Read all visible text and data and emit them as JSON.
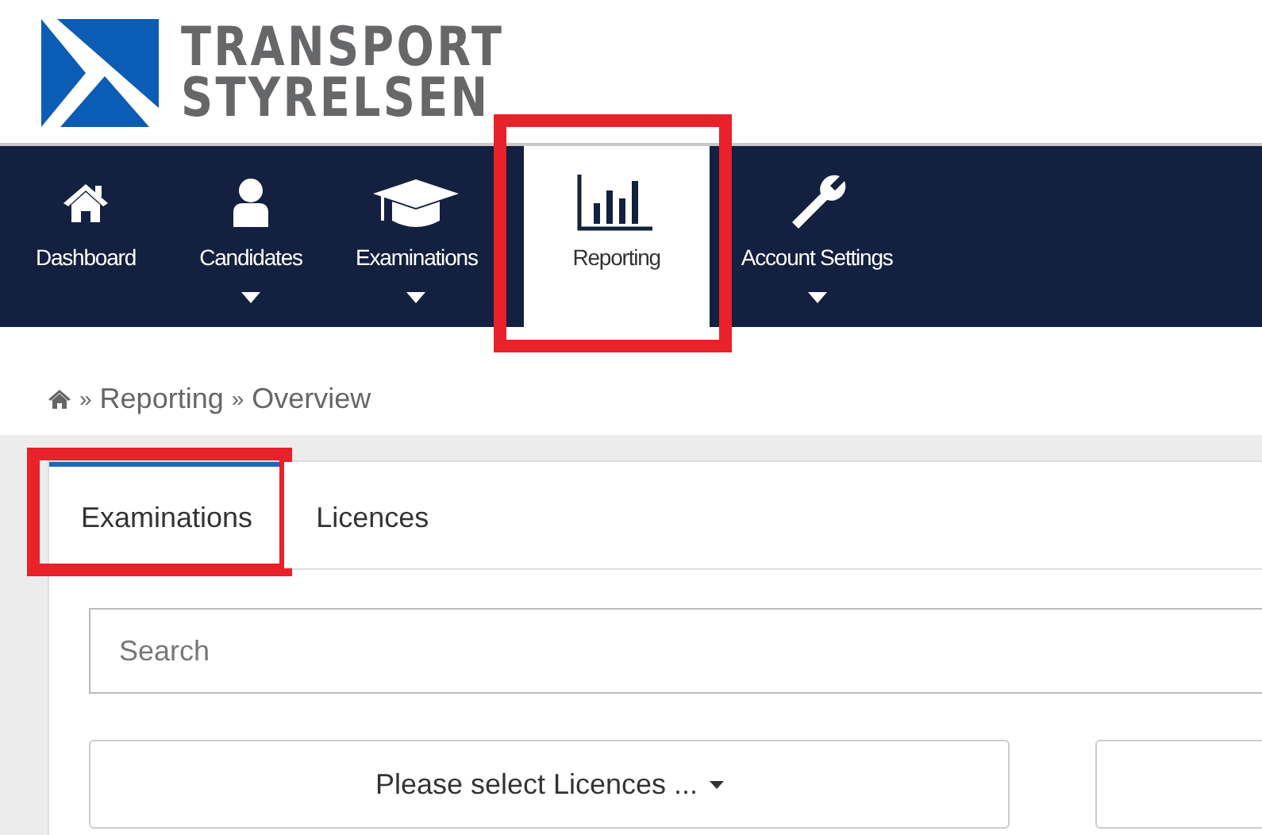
{
  "logo": {
    "line_1": "TRANSPORT",
    "line_2": "STYRELSEN"
  },
  "nav": [
    {
      "label": "Dashboard",
      "dropdown": false,
      "selected": false,
      "highlighted": false
    },
    {
      "label": "Candidates",
      "dropdown": true,
      "selected": false,
      "highlighted": false
    },
    {
      "label": "Examinations",
      "dropdown": true,
      "selected": false,
      "highlighted": false
    },
    {
      "label": "Reporting",
      "dropdown": false,
      "selected": true,
      "highlighted": true
    },
    {
      "label": "Account Settings",
      "dropdown": true,
      "selected": false,
      "highlighted": false
    }
  ],
  "breadcrumb": [
    {
      "separator": "»",
      "label": "Reporting"
    },
    {
      "separator": "»",
      "label": "Overview"
    }
  ],
  "tabs": [
    {
      "label": "Examinations",
      "selected": true,
      "highlighted": true
    },
    {
      "label": "Licences",
      "selected": false,
      "highlighted": false
    }
  ],
  "search": {
    "placeholder": "Search"
  },
  "filters": [
    {
      "kind": "dropdown",
      "label": "Please select Licences ..."
    },
    {
      "kind": "blank"
    }
  ]
}
